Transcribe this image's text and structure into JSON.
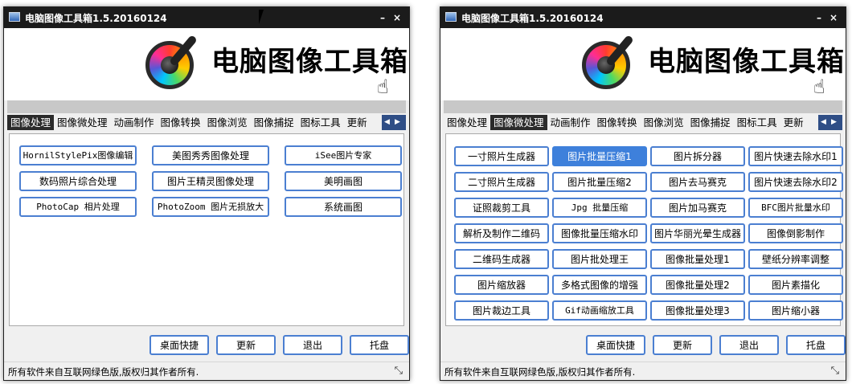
{
  "window_title": "电脑图像工具箱1.5.20160124",
  "brand_title": "电脑图像工具箱",
  "controls": {
    "minimize": "–",
    "close": "×",
    "prev": "◀",
    "next": "▶",
    "resize": "⤡"
  },
  "icons": {
    "app": "app-window-icon",
    "logo": "palette-eyedropper-icon",
    "hand": "pointing-hand-icon",
    "cursor": "mouse-cursor-icon"
  },
  "colors": {
    "accent": "#3e80db",
    "button_border": "#4b7fd1",
    "titlebar": "#1b1b1b",
    "tab_active": "#2b2b2b"
  },
  "hand_glyph": "☝",
  "tabs": [
    "图像处理",
    "图像微处理",
    "动画制作",
    "图像转换",
    "图像浏览",
    "图像捕捉",
    "图标工具",
    "更新"
  ],
  "left_window": {
    "active_tab": 0,
    "buttons": [
      "HornilStylePix图像编辑",
      "美图秀秀图像处理",
      "iSee图片专家",
      "数码照片综合处理",
      "图片王精灵图像处理",
      "美明画图",
      "PhotoCap 相片处理",
      "PhotoZoom 图片无损放大",
      "系统画图"
    ]
  },
  "right_window": {
    "active_tab": 1,
    "selected_button": 1,
    "buttons": [
      "一寸照片生成器",
      "图片批量压缩1",
      "图片拆分器",
      "图片快速去除水印1",
      "二寸照片生成器",
      "图片批量压缩2",
      "图片去马赛克",
      "图片快速去除水印2",
      "证照裁剪工具",
      "Jpg 批量压缩",
      "图片加马赛克",
      "BFC图片批量水印",
      "解析及制作二维码",
      "图像批量压缩水印",
      "图片华丽光晕生成器",
      "图像倒影制作",
      "二维码生成器",
      "图片批处理王",
      "图像批量处理1",
      "壁纸分辨率调整",
      "图片缩放器",
      "多格式图像的增强",
      "图像批量处理2",
      "图片素描化",
      "图片裁边工具",
      "Gif动画缩放工具",
      "图像批量处理3",
      "图片缩小器"
    ]
  },
  "bottom_buttons": [
    "桌面快捷",
    "更新",
    "退出",
    "托盘"
  ],
  "status_text": "所有软件来自互联网绿色版,版权归其作者所有."
}
